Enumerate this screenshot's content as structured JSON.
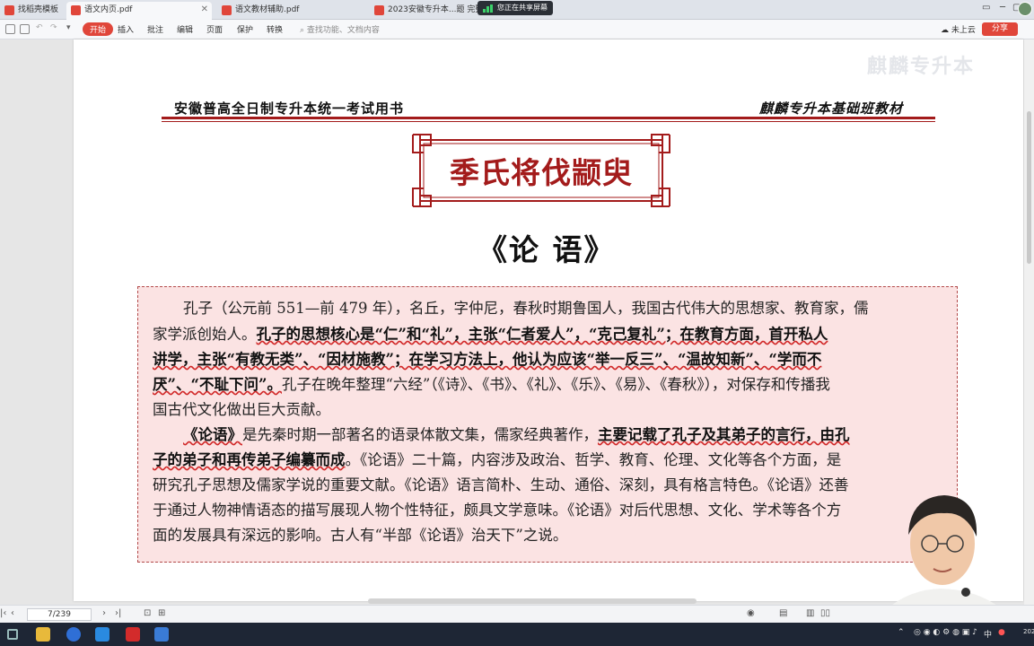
{
  "tabs": [
    {
      "label": "找稻壳模板",
      "active": false
    },
    {
      "label": "语文内页.pdf",
      "active": true
    },
    {
      "label": "语文教材辅助.pdf",
      "active": false
    },
    {
      "label": "2023安徽专升本...题 完整版.p",
      "active": false
    }
  ],
  "share_indicator": "您正在共享屏幕",
  "toolbar": {
    "start": "开始",
    "menus": [
      "插入",
      "批注",
      "编辑",
      "页面",
      "保护",
      "转换"
    ],
    "search_placeholder": "查找功能、文档内容",
    "cloud": "未上云",
    "share": "分享"
  },
  "document": {
    "header_left": "安徽普高全日制专升本统一考试用书",
    "header_right": "麒麟专升本基础班教材",
    "watermark": "麒麟专升本",
    "chapter_title": "季氏将伐颛臾",
    "book_title": "《论  语》",
    "paragraphs": {
      "l1": "孔子（公元前 551—前 479 年），名丘，字仲尼，春秋时期鲁国人，我国古代伟大的思想家、教育家，儒",
      "l2a": "家学派创始人。",
      "l2b": "孔子的思想核心是“仁”和“礼”，主张“仁者爱人”，“克己复礼”；在教育方面，首开私人",
      "l3": "讲学，主张“有教无类”、“因材施教”；在学习方法上，他认为应该“举一反三”、“温故知新”、“学而不",
      "l4a": "厌”、“不耻下问”。",
      "l4b": "孔子在晚年整理“六经”（《诗》、《书》、《礼》、《乐》、《易》、《春秋》），对保存和传播我",
      "l5": "国古代文化做出巨大贡献。",
      "l6a": "《论语》",
      "l6b": "是先秦时期一部著名的语录体散文集，儒家经典著作，",
      "l6c": "主要记载了孔子及其弟子的言行，由孔",
      "l7a": "子的弟子和再传弟子编纂而成",
      "l7b": "。《论语》二十篇，内容涉及政治、哲学、教育、伦理、文化等各个方面，是",
      "l8": "研究孔子思想及儒家学说的重要文献。《论语》语言简朴、生动、通俗、深刻，具有格言特色。《论语》还善",
      "l9": "于通过人物神情语态的描写展现人物个性特征，颇具文学意味。《论语》对后代思想、文化、学术等各个方",
      "l10": "面的发展具有深远的影响。古人有“半部《论语》治天下”之说。"
    }
  },
  "status": {
    "page_indicator": "7/239"
  },
  "taskbar": {
    "lang": "中",
    "year_fragment": "202"
  },
  "colors": {
    "accent_red": "#a31b1b",
    "box_bg": "#fbe3e3",
    "wps_red": "#e0463a",
    "taskbar": "#1e2635"
  }
}
